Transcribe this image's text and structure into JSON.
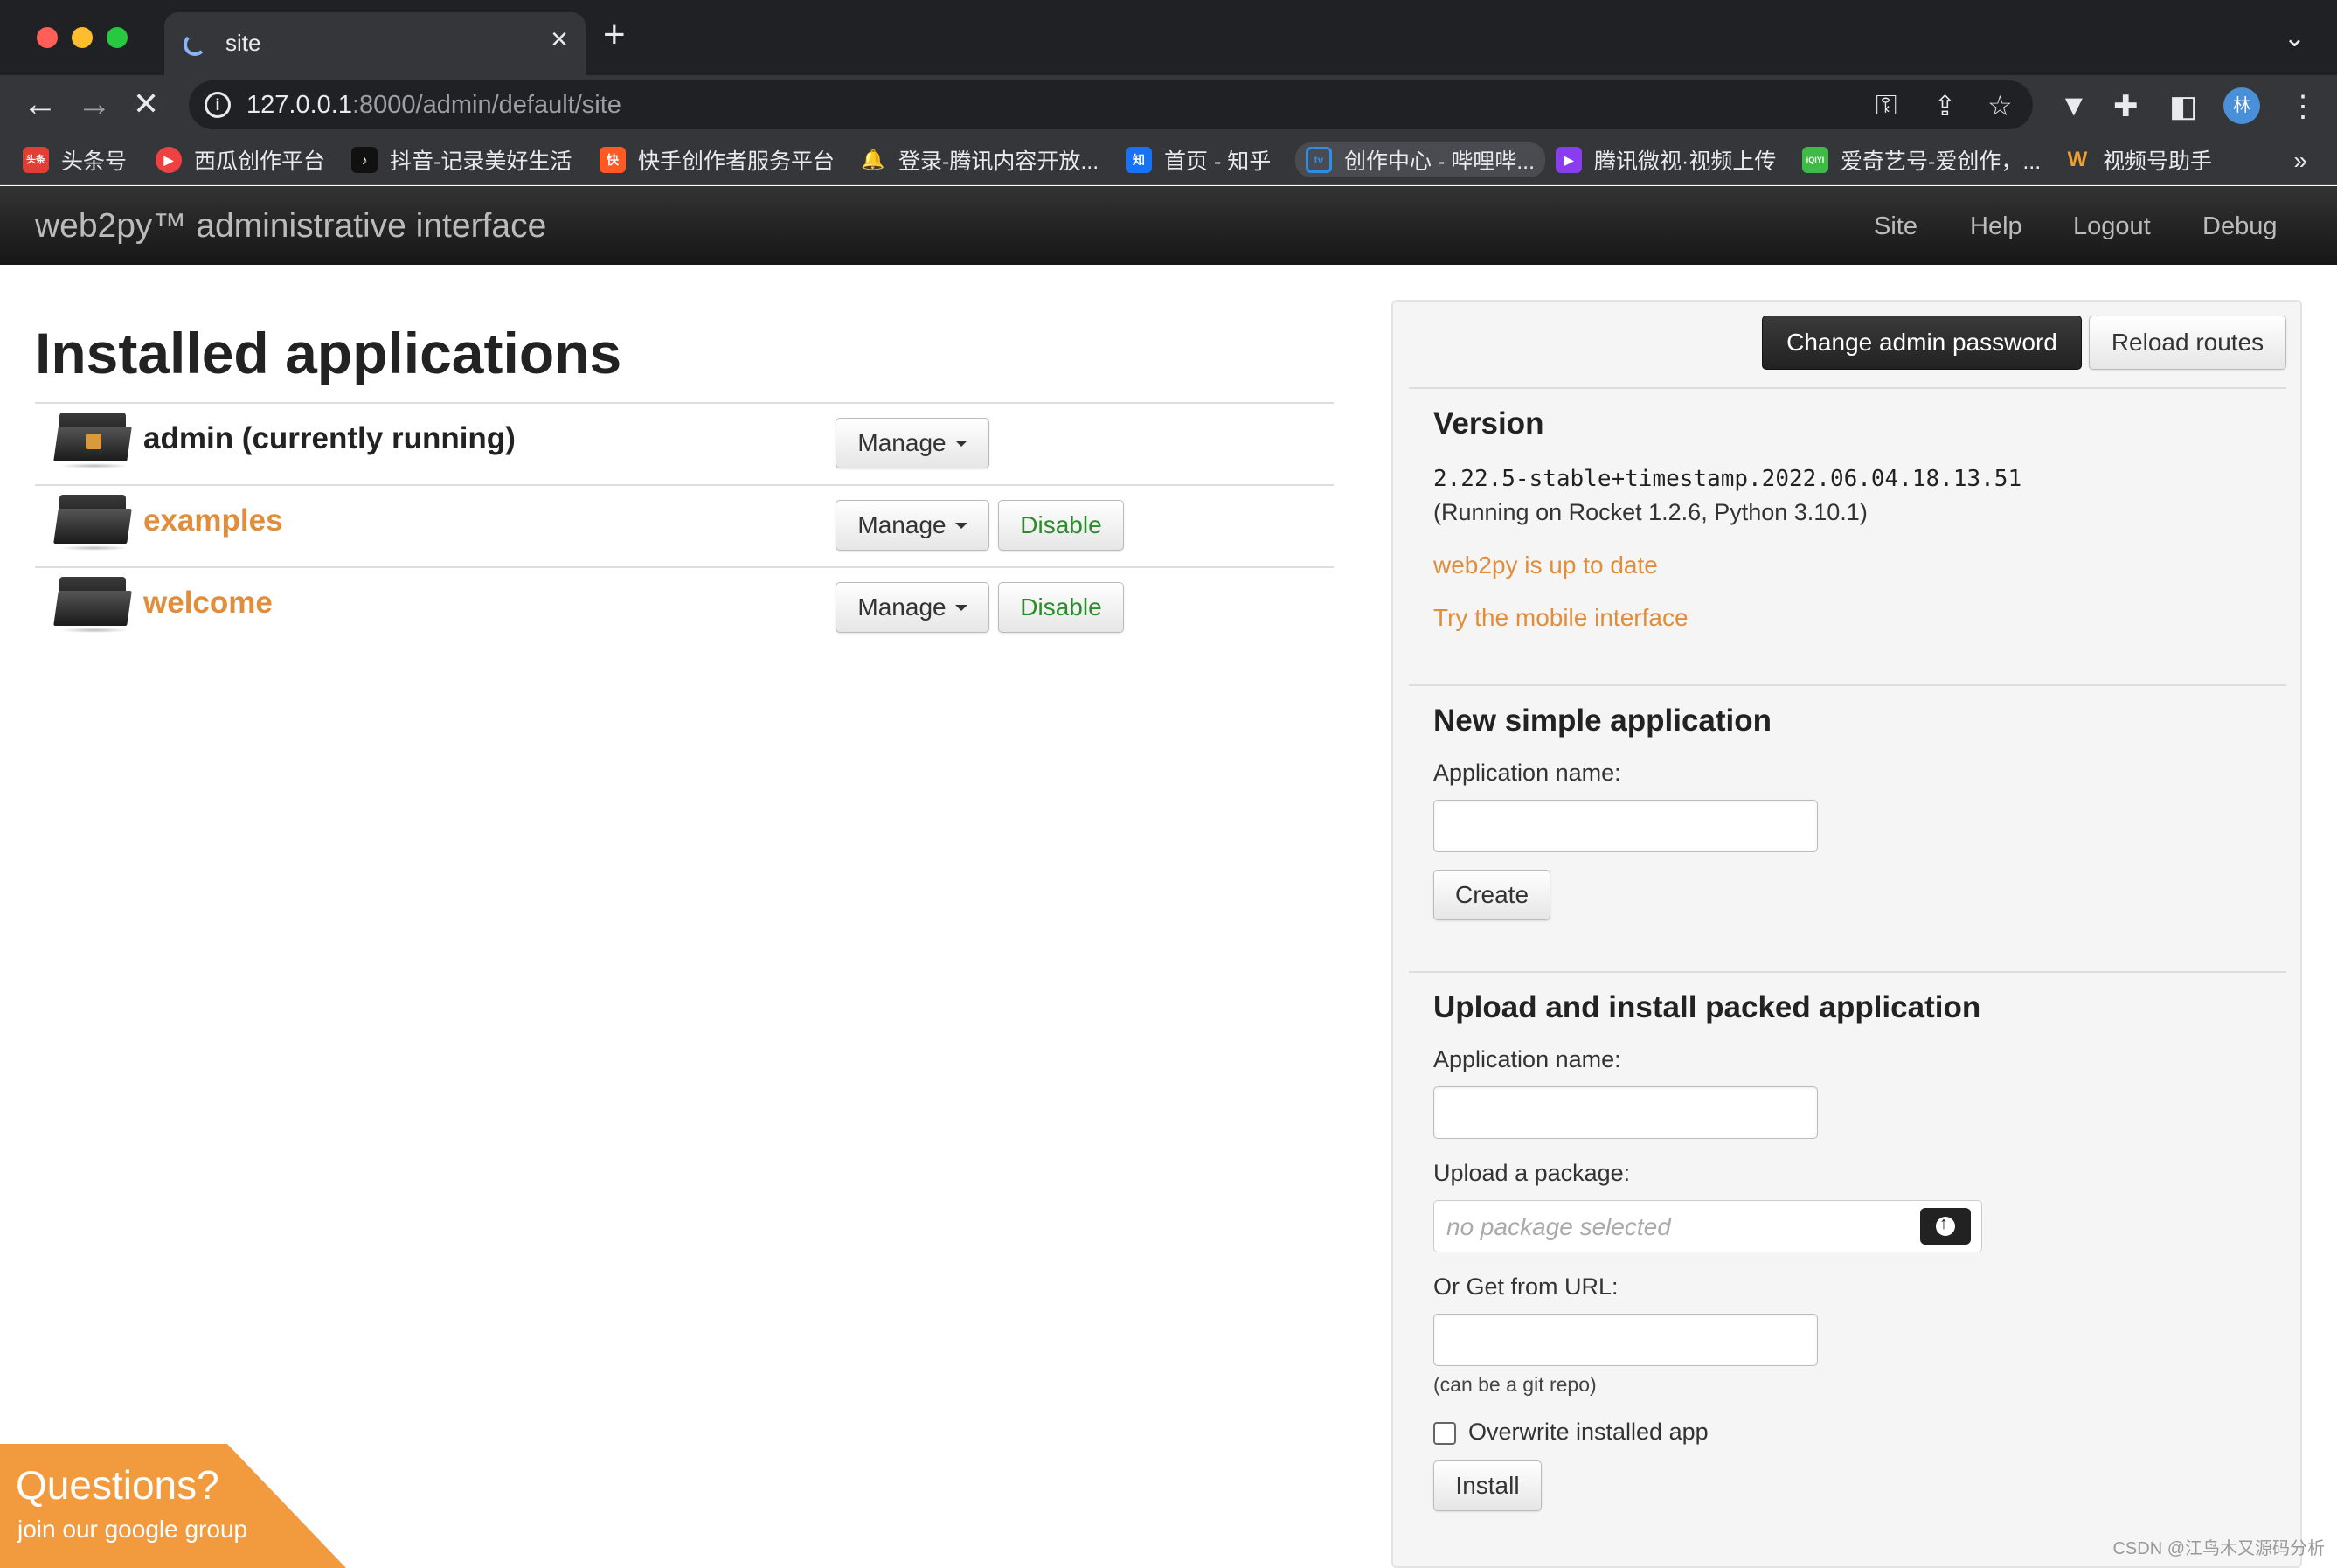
{
  "browser": {
    "tab_title": "site",
    "url_host": "127.0.0.1",
    "url_rest": ":8000/admin/default/site",
    "bookmarks": [
      {
        "label": "头条号",
        "icon_text": "头条",
        "color": "#e33e33"
      },
      {
        "label": "西瓜创作平台",
        "icon_text": "▶",
        "color": "#f04142"
      },
      {
        "label": "抖音-记录美好生活",
        "icon_text": "♪",
        "color": "#111111"
      },
      {
        "label": "快手创作者服务平台",
        "icon_text": "快",
        "color": "#ff5a24"
      },
      {
        "label": "登录-腾讯内容开放...",
        "icon_text": "🔔",
        "color": "#f5c12b"
      },
      {
        "label": "首页 - 知乎",
        "icon_text": "知",
        "color": "#1772f6"
      },
      {
        "label": "创作中心 - 哔哩哔...",
        "icon_text": "tv",
        "color": "#2f8de4"
      },
      {
        "label": "腾讯微视·视频上传",
        "icon_text": "▶",
        "color": "#8a3cf0"
      },
      {
        "label": "爱奇艺号-爱创作，...",
        "icon_text": "iQIYI",
        "color": "#3fba46"
      },
      {
        "label": "视频号助手",
        "icon_text": "W",
        "color": "#f0a030"
      }
    ],
    "avatar_text": "林",
    "more_bookmarks": "»"
  },
  "navbar": {
    "brand": "web2py™ administrative interface",
    "links": [
      "Site",
      "Help",
      "Logout",
      "Debug"
    ]
  },
  "main": {
    "title": "Installed applications",
    "apps": [
      {
        "name": "admin (currently running)",
        "manage_label": "Manage",
        "disable_label": ""
      },
      {
        "name": "examples",
        "manage_label": "Manage",
        "disable_label": "Disable"
      },
      {
        "name": "welcome",
        "manage_label": "Manage",
        "disable_label": "Disable"
      }
    ]
  },
  "sidebar": {
    "change_password": "Change admin password",
    "reload_routes": "Reload routes",
    "version": {
      "heading": "Version",
      "version_string": "2.22.5-stable+timestamp.2022.06.04.18.13.51",
      "running_on": "(Running on Rocket 1.2.6, Python 3.10.1)",
      "up_to_date": "web2py is up to date",
      "mobile": "Try the mobile interface"
    },
    "new_app": {
      "heading": "New simple application",
      "name_label": "Application name:",
      "create_label": "Create"
    },
    "upload": {
      "heading": "Upload and install packed application",
      "name_label": "Application name:",
      "package_label": "Upload a package:",
      "package_placeholder": "no package selected",
      "url_label": "Or Get from URL:",
      "url_hint": "(can be a git repo)",
      "overwrite_label": "Overwrite installed app",
      "install_label": "Install"
    }
  },
  "corner": {
    "line1": "Questions?",
    "line2": "join our google group"
  },
  "watermark": "CSDN @江鸟木又源码分析"
}
